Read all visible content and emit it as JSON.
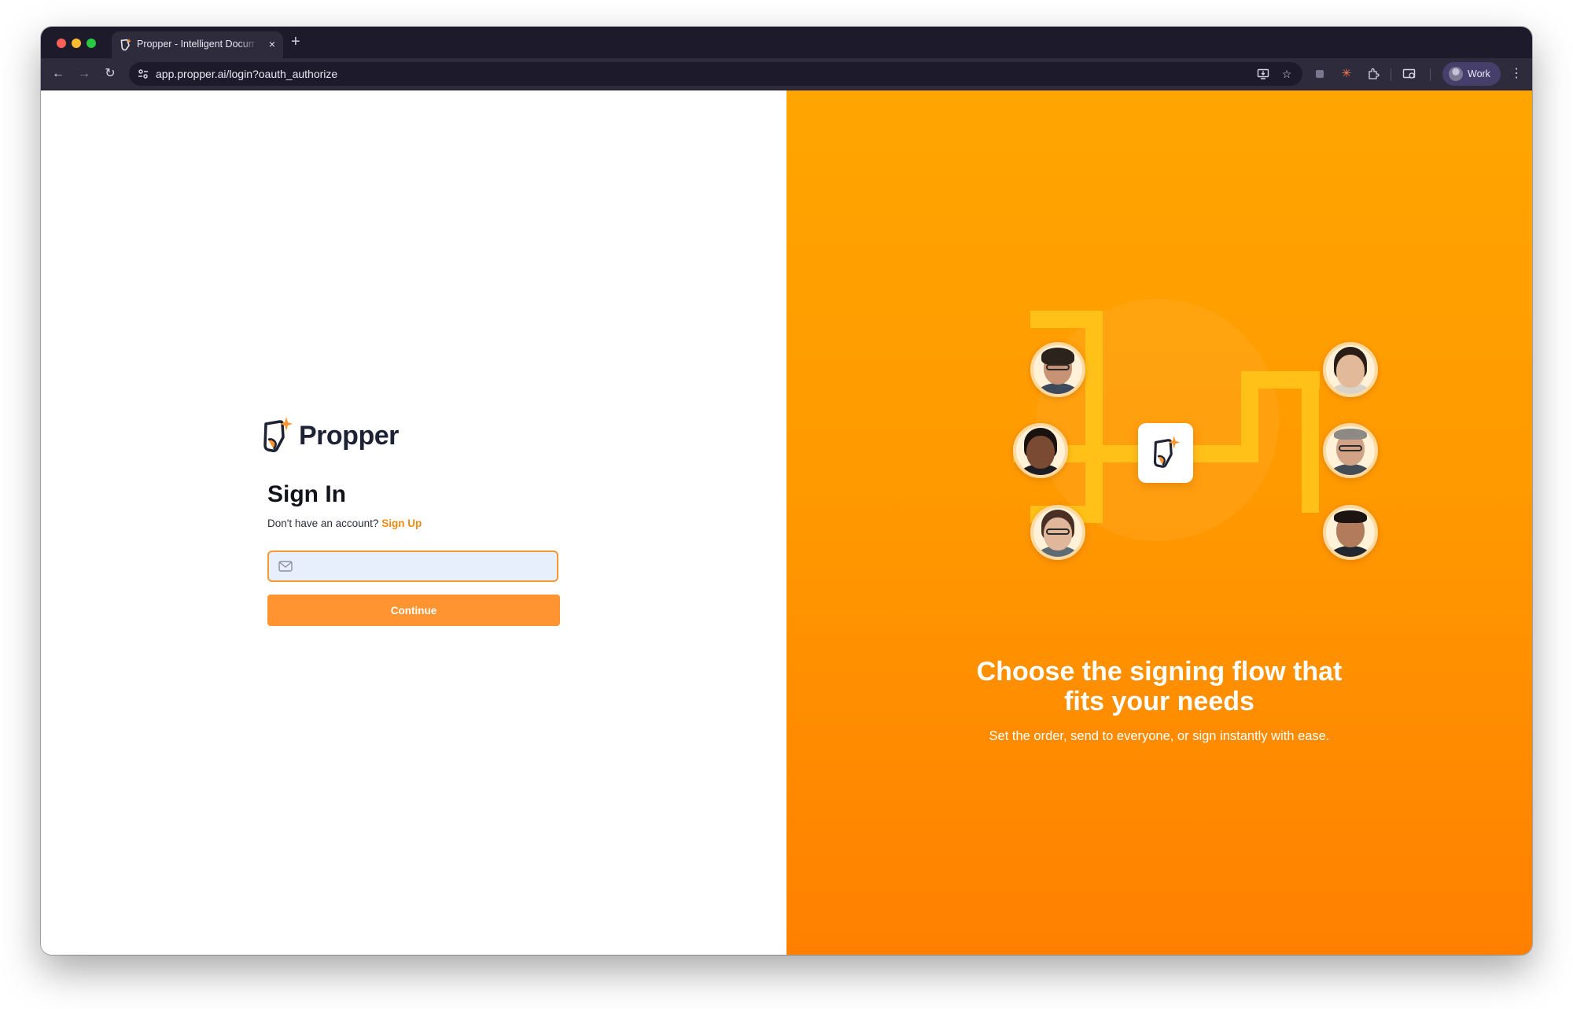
{
  "browser": {
    "tab_title": "Propper - Intelligent Document",
    "tab_close": "×",
    "new_tab": "+",
    "url": "app.propper.ai/login?oauth_authorize",
    "profile_label": "Work",
    "nav_back": "←",
    "nav_forward": "→",
    "nav_reload": "↻",
    "menu": "⋮"
  },
  "brand": {
    "name": "Propper",
    "accent_color": "#ff9431",
    "link_color": "#f28a0f"
  },
  "login": {
    "title": "Sign In",
    "no_account_text": "Don't have an account?",
    "signup_link": "Sign Up",
    "email_placeholder": "",
    "continue_label": "Continue"
  },
  "promo": {
    "headline_line1": "Choose the signing flow that",
    "headline_line2": "fits your needs",
    "subline": "Set the order, send to everyone, or sign instantly with ease."
  },
  "icons": [
    "propper-logo-icon",
    "mail-icon",
    "install-app-icon",
    "star-icon",
    "extensions-icon",
    "split-view-icon"
  ]
}
